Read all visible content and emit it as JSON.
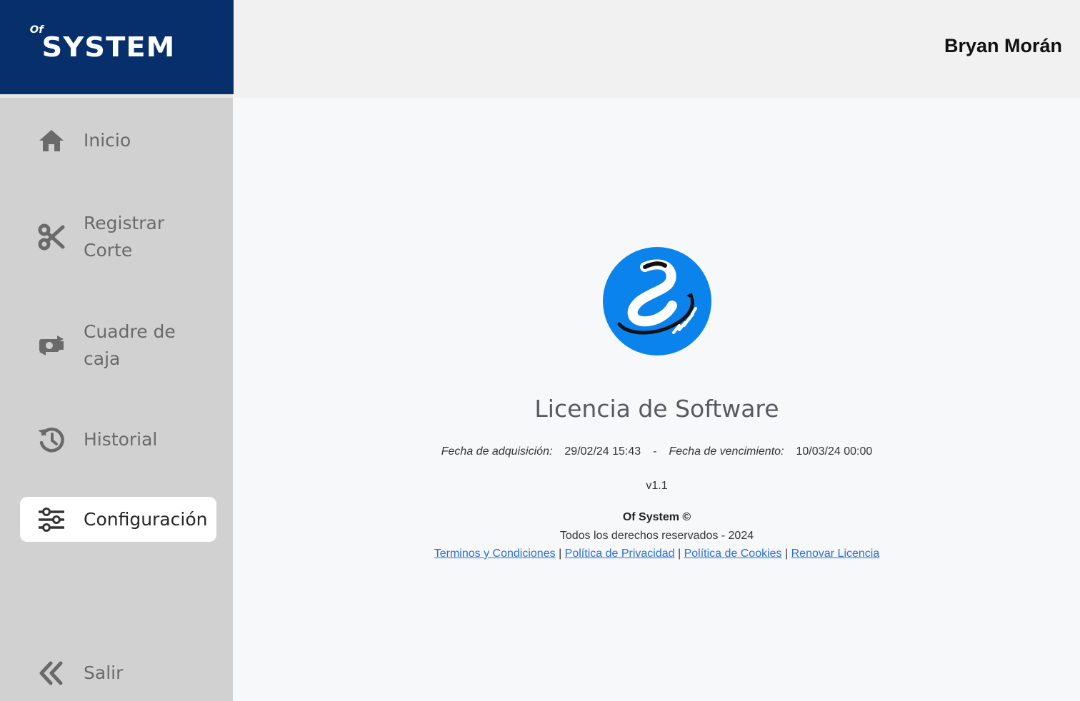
{
  "brand": {
    "prefix": "Of",
    "name": "SYSTEM"
  },
  "header": {
    "user_name": "Bryan Morán"
  },
  "sidebar": {
    "items": [
      {
        "label": "Inicio",
        "icon": "home-icon"
      },
      {
        "label": "Registrar Corte",
        "icon": "scissors-icon"
      },
      {
        "label": "Cuadre de caja",
        "icon": "money-exchange-icon"
      },
      {
        "label": "Historial",
        "icon": "history-icon"
      },
      {
        "label": "Configuración",
        "icon": "sliders-icon",
        "active": true
      },
      {
        "label": "Salir",
        "icon": "double-chevron-left-icon"
      }
    ]
  },
  "license": {
    "logo_icon": "app-logo-icon",
    "title": "Licencia de Software",
    "acquisition_label": "Fecha de adquisición:",
    "acquisition_date": "29/02/24 15:43",
    "separator": "-",
    "expiration_label": "Fecha de vencimiento:",
    "expiration_date": "10/03/24 00:00",
    "version": "v1.1",
    "company": "Of System ©",
    "rights": "Todos los derechos reservados - 2024",
    "links": [
      "Terminos y Condiciones",
      "Política de Privacidad",
      "Política de Cookies",
      "Renovar Licencia"
    ],
    "link_separator": "|"
  },
  "colors": {
    "brand_bg": "#062f6c",
    "sidebar_bg": "#d1d1d1",
    "logo_blue": "#0b83ec",
    "link": "#2b6fd6"
  }
}
